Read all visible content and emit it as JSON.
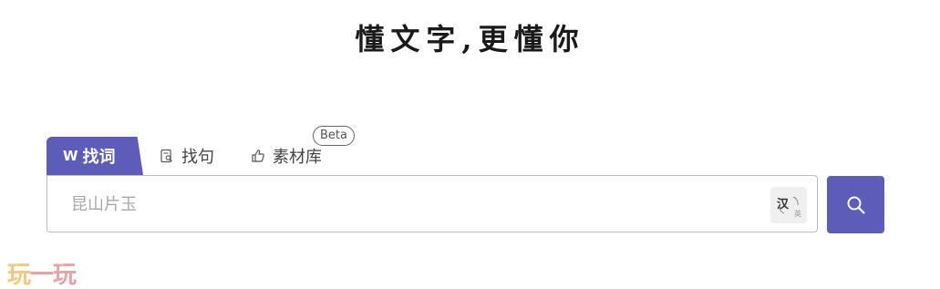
{
  "slogan": "懂文字,更懂你",
  "tabs": [
    {
      "label": "找词",
      "icon": "word-icon",
      "icon_text": "W"
    },
    {
      "label": "找句",
      "icon": "sentence-icon"
    },
    {
      "label": "素材库",
      "icon": "material-icon",
      "badge": "Beta"
    }
  ],
  "search": {
    "placeholder": "昆山片玉",
    "value": "",
    "lang_toggle": {
      "zh": "汉",
      "en": "英"
    }
  },
  "watermark": {
    "part1": "玩",
    "part2": "一",
    "part3": "玩"
  },
  "colors": {
    "accent": "#5d5cb9",
    "border": "#bcbcbc",
    "placeholder": "#a8a8a8"
  }
}
